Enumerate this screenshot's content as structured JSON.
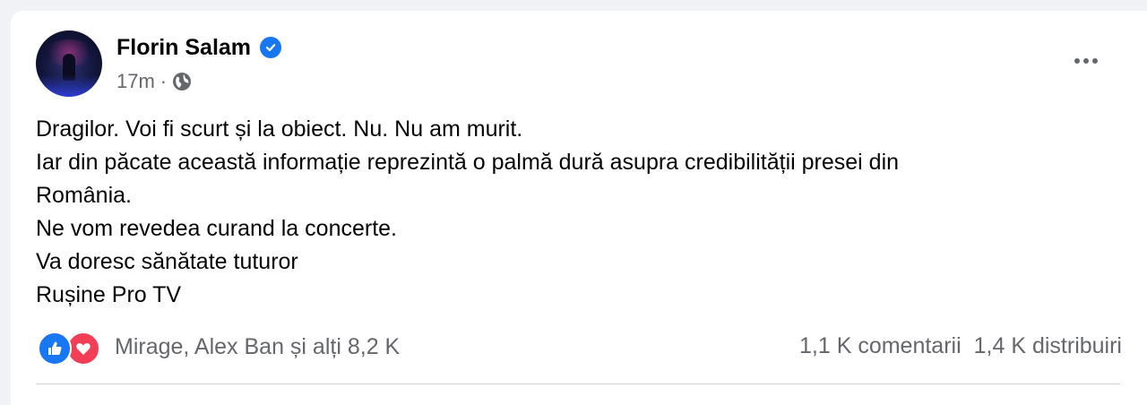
{
  "post": {
    "author": "Florin Salam",
    "verified": true,
    "time": "17m",
    "separator": "·",
    "privacy_icon": "globe-icon",
    "lines": [
      "Dragilor. Voi fi scurt și la obiect. Nu. Nu am murit.",
      "Iar din păcate această informație reprezintă o palmă dură asupra credibilității presei din",
      "România.",
      "Ne vom revedea curand la concerte.",
      "Va doresc sănătate tuturor",
      "Rușine Pro TV"
    ]
  },
  "reactions": {
    "icons": [
      "like-icon",
      "love-icon"
    ],
    "summary": "Mirage, Alex Ban și alți 8,2 K"
  },
  "stats": {
    "comments": "1,1 K comentarii",
    "shares": "1,4 K distribuiri"
  },
  "colors": {
    "accent": "#1877f2",
    "love": "#f33e58",
    "secondary_text": "#65676b"
  }
}
